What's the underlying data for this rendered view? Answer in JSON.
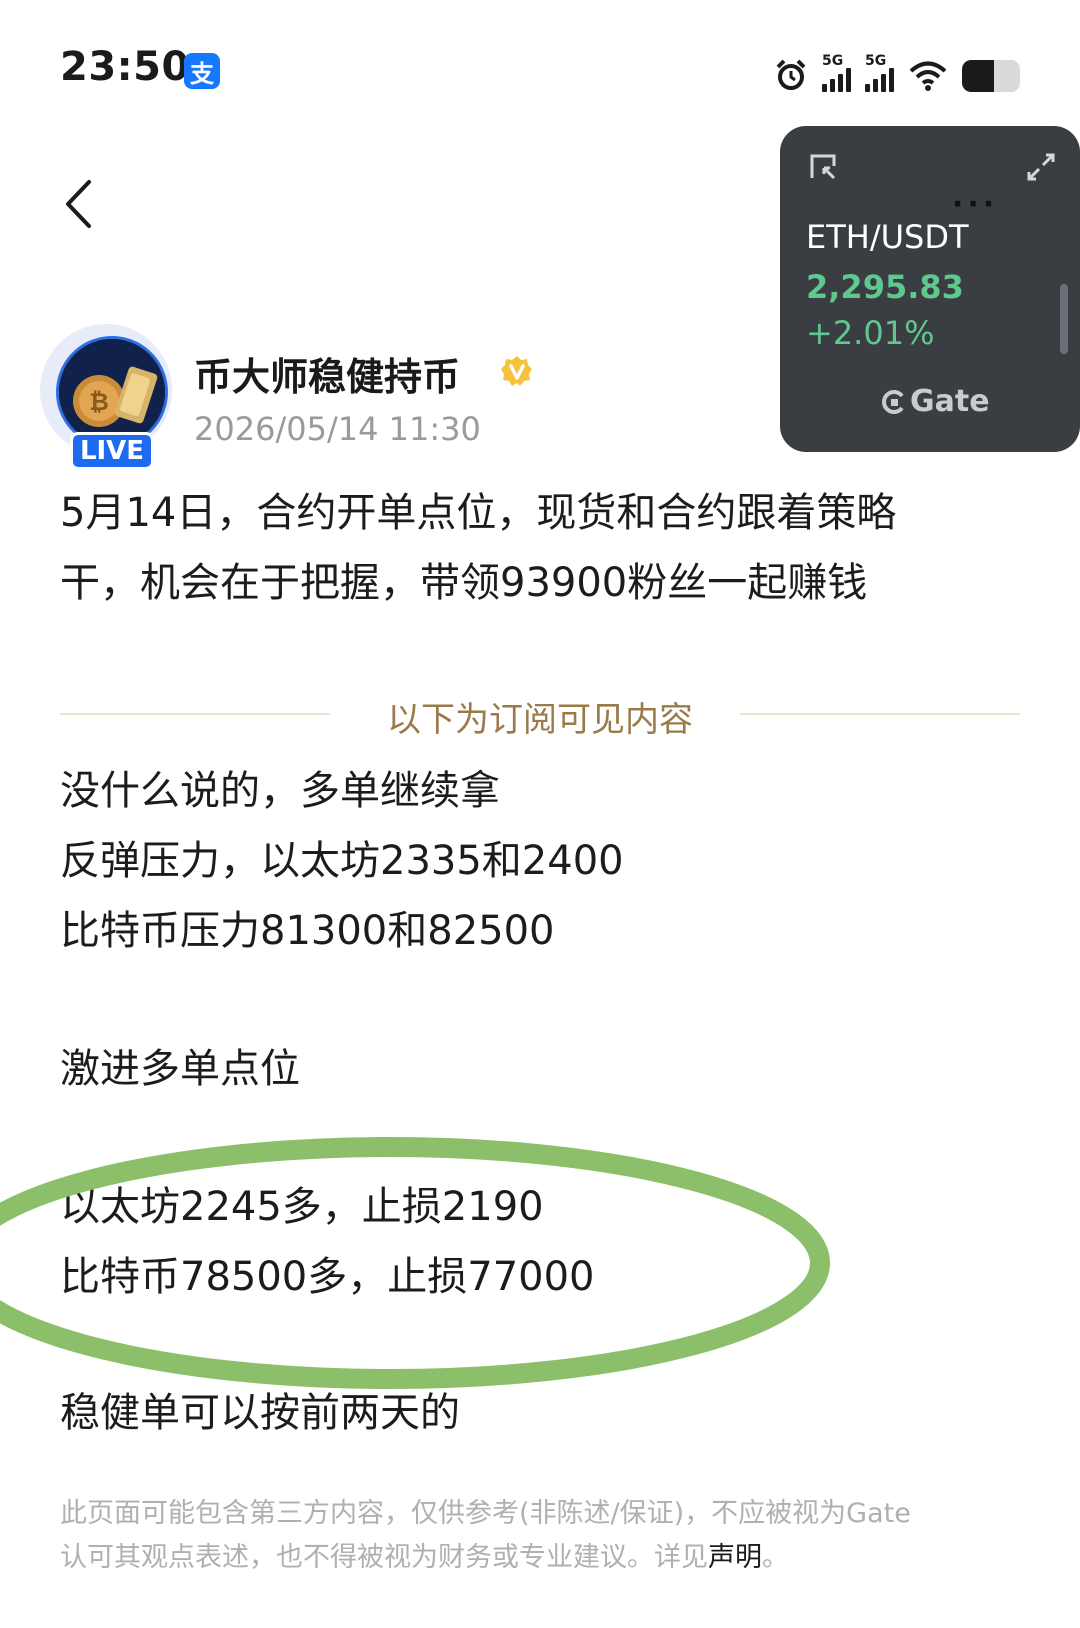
{
  "status_bar": {
    "time": "23:50",
    "pay_badge": "支",
    "signal1_label": "5G",
    "signal2_label": "5G",
    "battery_level": 0.55
  },
  "widget": {
    "pair": "ETH/USDT",
    "price": "2,295.83",
    "change": "+2.01%",
    "brand": "Gate",
    "colors": {
      "positive": "#5fc88f",
      "background": "#3a3d42"
    }
  },
  "author": {
    "name": "币大师稳健持币",
    "timestamp": "2026/05/14 11:30",
    "live_badge": "LIVE",
    "verified_icon": "verified-badge-icon"
  },
  "post": {
    "intro_line1": "5月14日，合约开单点位，现货和合约跟着策略",
    "intro_line2": "干，机会在于把握，带领93900粉丝一起赚钱",
    "divider_label": "以下为订阅可见内容",
    "body_line1": "没什么说的，多单继续拿",
    "body_line2": "反弹压力，以太坊2335和2400",
    "body_line3": "比特币压力81300和82500",
    "section_title": "激进多单点位",
    "highlight_line1": "以太坊2245多，止损2190",
    "highlight_line2": "比特币78500多，止损77000",
    "closing_line": "稳健单可以按前两天的"
  },
  "disclaimer": {
    "line1": "此页面可能包含第三方内容，仅供参考(非陈述/保证)，不应被视为Gate",
    "line2_prefix": "认可其观点表述，也不得被视为财务或专业建议。详见",
    "link_text": "声明",
    "line2_suffix": "。"
  },
  "accent_colors": {
    "highlight_ellipse": "#8cbf6a",
    "divider_text": "#9a7a48"
  }
}
